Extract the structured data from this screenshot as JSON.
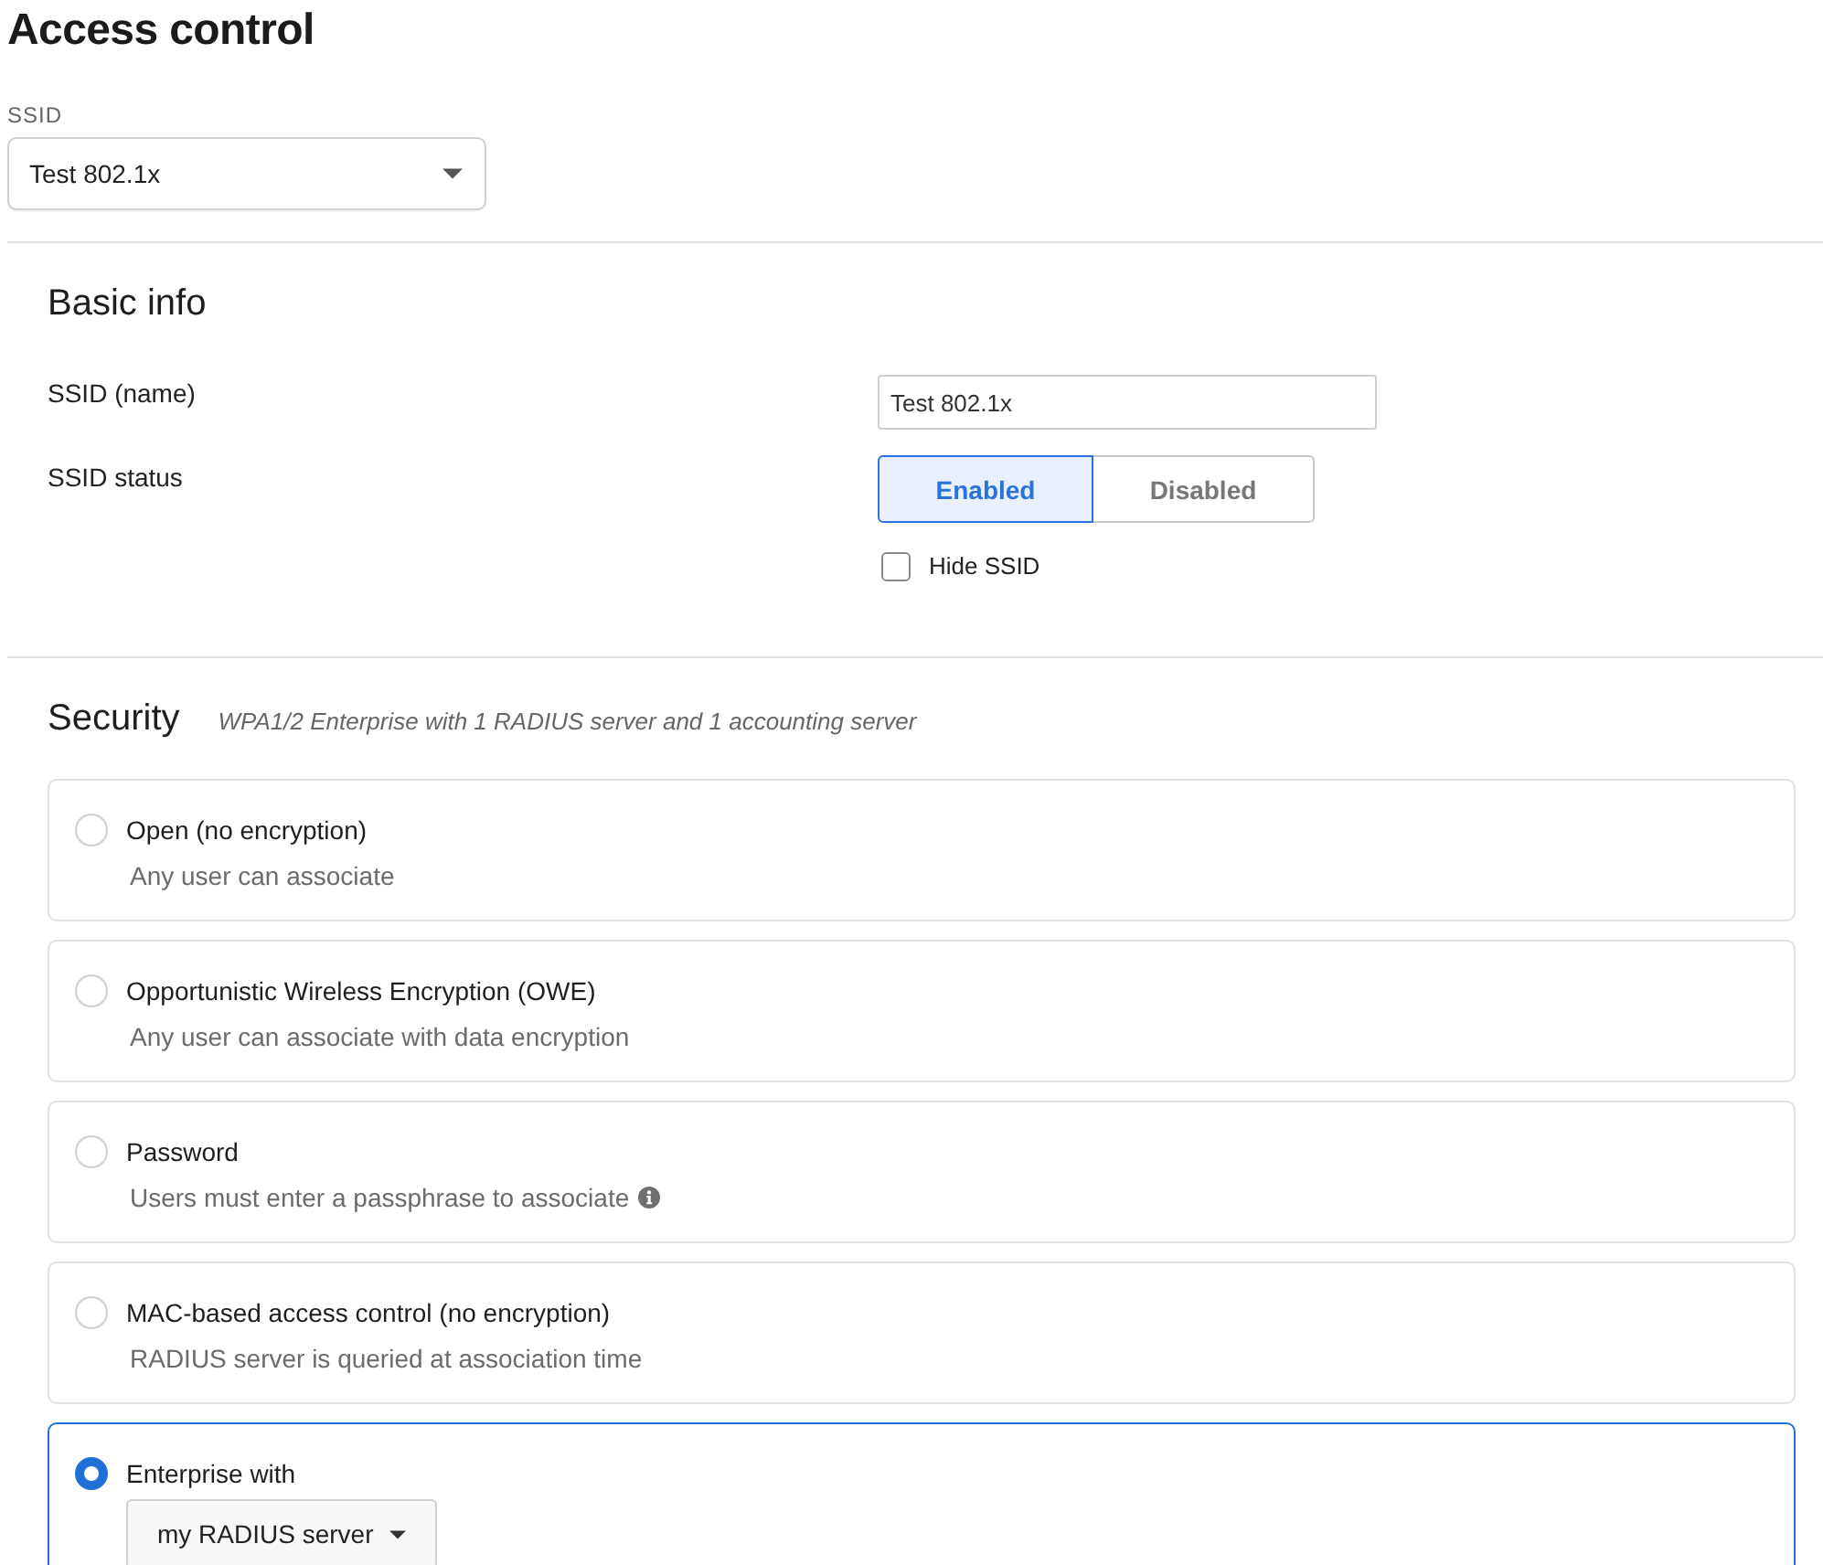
{
  "page": {
    "title": "Access control"
  },
  "ssid_selector": {
    "label": "SSID",
    "value": "Test 802.1x"
  },
  "basic_info": {
    "title": "Basic info",
    "name_field": {
      "label": "SSID (name)",
      "value": "Test 802.1x"
    },
    "status": {
      "label": "SSID status",
      "options": [
        {
          "label": "Enabled",
          "selected": true
        },
        {
          "label": "Disabled",
          "selected": false
        }
      ]
    },
    "hide_ssid": {
      "label": "Hide SSID",
      "checked": false
    }
  },
  "security": {
    "title": "Security",
    "summary": "WPA1/2 Enterprise with 1 RADIUS server and 1 accounting server",
    "options": [
      {
        "kind": "text",
        "title": "Open (no encryption)",
        "description": "Any user can associate",
        "selected": false
      },
      {
        "kind": "text",
        "title": "Opportunistic Wireless Encryption (OWE)",
        "description": "Any user can associate with data encryption",
        "selected": false
      },
      {
        "kind": "info",
        "title": "Password",
        "description": "Users must enter a passphrase to associate",
        "selected": false
      },
      {
        "kind": "text",
        "title": "MAC-based access control (no encryption)",
        "description": "RADIUS server is queried at association time",
        "selected": false
      },
      {
        "kind": "select",
        "title": "Enterprise with",
        "dropdown": "my RADIUS server",
        "selected": true
      }
    ]
  }
}
